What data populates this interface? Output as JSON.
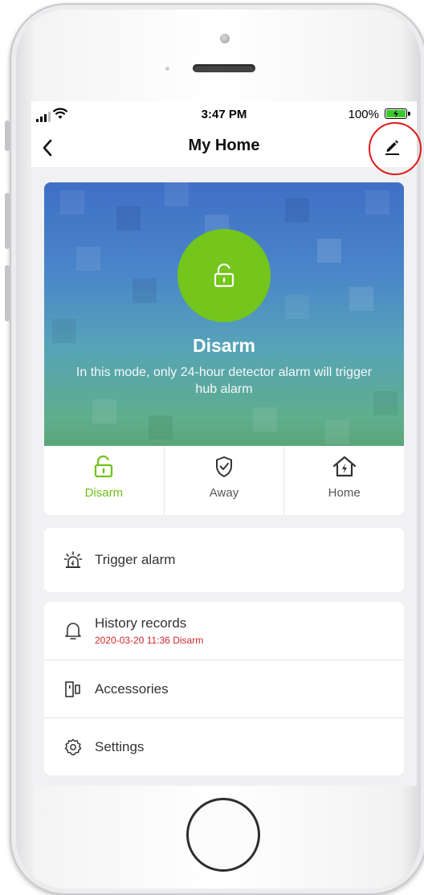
{
  "status_bar": {
    "time": "3:47 PM",
    "battery": "100%"
  },
  "nav": {
    "title": "My Home",
    "back_icon": "chevron-left-icon",
    "edit_icon": "pencil-icon"
  },
  "hero": {
    "mode_title": "Disarm",
    "description": "In this mode, only 24-hour detector alarm will trigger hub alarm",
    "state_icon": "unlock-icon",
    "accent_color": "#74c51c"
  },
  "modes": [
    {
      "label": "Disarm",
      "icon": "unlock-icon",
      "active": true
    },
    {
      "label": "Away",
      "icon": "shield-check-icon",
      "active": false
    },
    {
      "label": "Home",
      "icon": "home-bolt-icon",
      "active": false
    }
  ],
  "trigger": {
    "label": "Trigger alarm",
    "icon": "siren-icon"
  },
  "menu": {
    "history_label": "History records",
    "history_sub": "2020-03-20 11:36 Disarm",
    "accessories_label": "Accessories",
    "settings_label": "Settings"
  }
}
